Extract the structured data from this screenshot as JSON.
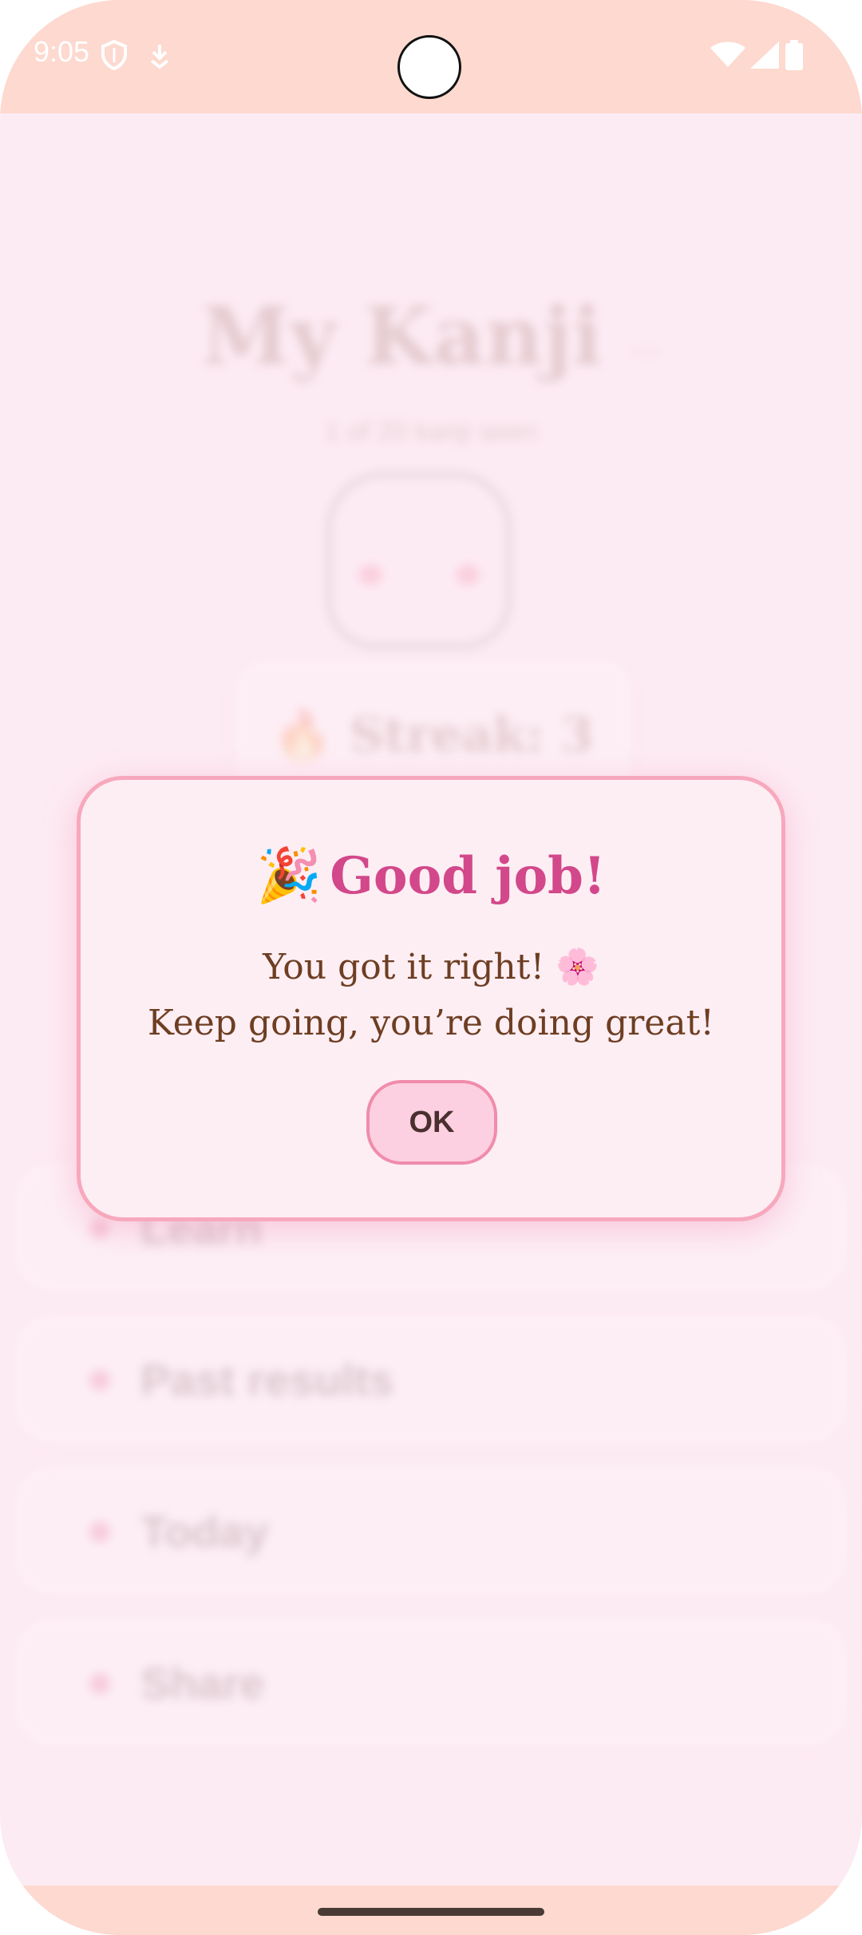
{
  "status_bar": {
    "time": "9:05",
    "left_icons": [
      "shield-icon",
      "download-icon"
    ],
    "right_icons": [
      "wifi-icon",
      "signal-icon",
      "battery-icon"
    ]
  },
  "background": {
    "title": "My Kanji",
    "title_suffix": "...",
    "subtitle": "1 of 20 kanji seen",
    "streak": "🔥 Streak: 3",
    "menu_items": [
      {
        "label": "Learn"
      },
      {
        "label": "Past results"
      },
      {
        "label": "Today"
      },
      {
        "label": "Share"
      }
    ]
  },
  "dialog": {
    "emoji": "🎉",
    "title": "Good job!",
    "message_line1": "You got it right! 🌸",
    "message_line2": "Keep going, you’re doing great!",
    "ok_label": "OK"
  },
  "colors": {
    "accent": "#d2488a",
    "dialog_border": "#f7a8bd",
    "button_fill": "#fcd0e0",
    "status_bar": "#fdd9cf",
    "background": "#fdebf4"
  }
}
